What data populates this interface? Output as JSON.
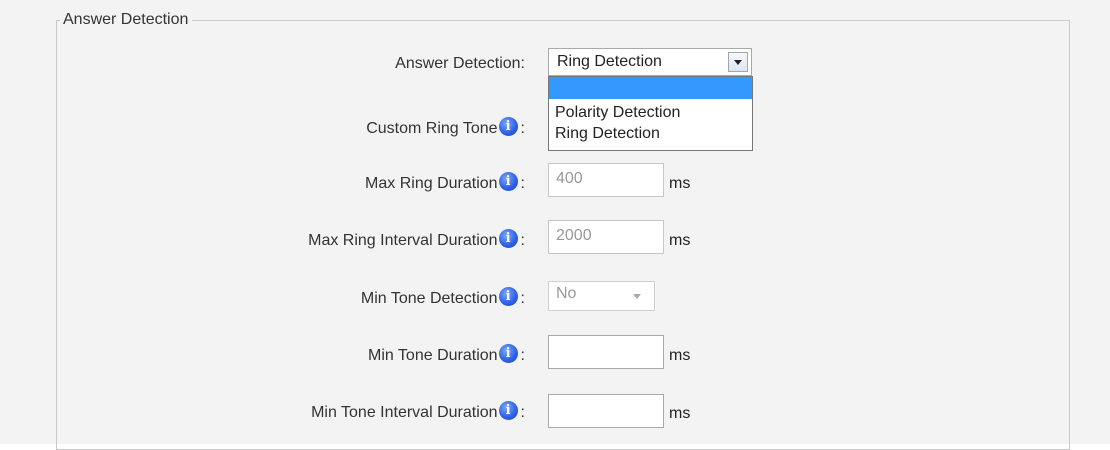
{
  "section": {
    "legend": "Answer Detection"
  },
  "fields": {
    "answer_detection": {
      "label": "Answer Detection:",
      "selected": "Ring Detection",
      "options": [
        "",
        "Polarity Detection",
        "Ring Detection"
      ]
    },
    "custom_ring_tone": {
      "label": "Custom Ring Tone",
      "colon": ":"
    },
    "max_ring_duration": {
      "label": "Max Ring Duration",
      "colon": ":",
      "value": "400",
      "unit": "ms"
    },
    "max_ring_interval_duration": {
      "label": "Max Ring Interval Duration",
      "colon": ":",
      "value": "2000",
      "unit": "ms"
    },
    "min_tone_detection": {
      "label": "Min Tone Detection",
      "colon": ":",
      "selected": "No"
    },
    "min_tone_duration": {
      "label": "Min Tone Duration",
      "colon": ":",
      "value": "",
      "unit": "ms"
    },
    "min_tone_interval_duration": {
      "label": "Min Tone Interval Duration",
      "colon": ":",
      "value": "",
      "unit": "ms"
    }
  },
  "icons": {
    "info": "info-icon",
    "info_glyph": "i"
  },
  "colors": {
    "highlight": "#3399ff",
    "info_icon": "#2f63e6",
    "panel_bg": "#f3f3f3"
  }
}
